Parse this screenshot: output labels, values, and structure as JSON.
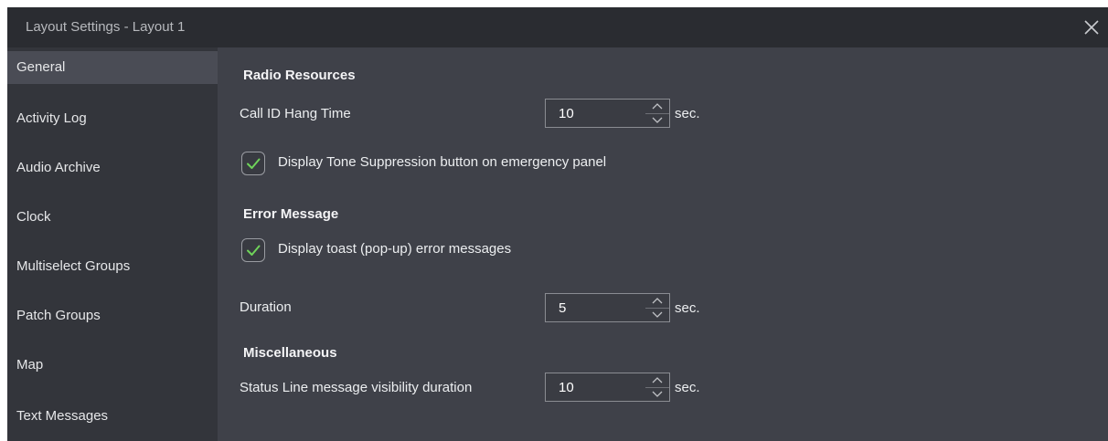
{
  "window": {
    "title": "Layout Settings - Layout 1"
  },
  "sidebar": {
    "items": [
      {
        "label": "General"
      },
      {
        "label": "Activity Log"
      },
      {
        "label": "Audio Archive"
      },
      {
        "label": "Clock"
      },
      {
        "label": "Multiselect Groups"
      },
      {
        "label": "Patch Groups"
      },
      {
        "label": "Map"
      },
      {
        "label": "Text Messages"
      }
    ],
    "active": "General"
  },
  "sections": {
    "radio_resources": {
      "heading": "Radio Resources",
      "call_id_hang_time": {
        "label": "Call ID Hang Time",
        "value": "10",
        "unit": "sec."
      },
      "tone_suppression": {
        "label": "Display Tone Suppression button on emergency panel",
        "checked": true
      }
    },
    "error_message": {
      "heading": "Error Message",
      "toast": {
        "label": "Display toast (pop-up) error messages",
        "checked": true
      },
      "duration": {
        "label": "Duration",
        "value": "5",
        "unit": "sec."
      }
    },
    "miscellaneous": {
      "heading": "Miscellaneous",
      "status_line": {
        "label": "Status Line message visibility duration",
        "value": "10",
        "unit": "sec."
      }
    }
  },
  "colors": {
    "accent_check": "#6fd35a",
    "sidebar_active": "#4a4c55",
    "background": "#3f4149"
  },
  "icons": {
    "close": "close-icon",
    "check": "checkmark-icon",
    "up": "chevron-up-icon",
    "down": "chevron-down-icon"
  }
}
